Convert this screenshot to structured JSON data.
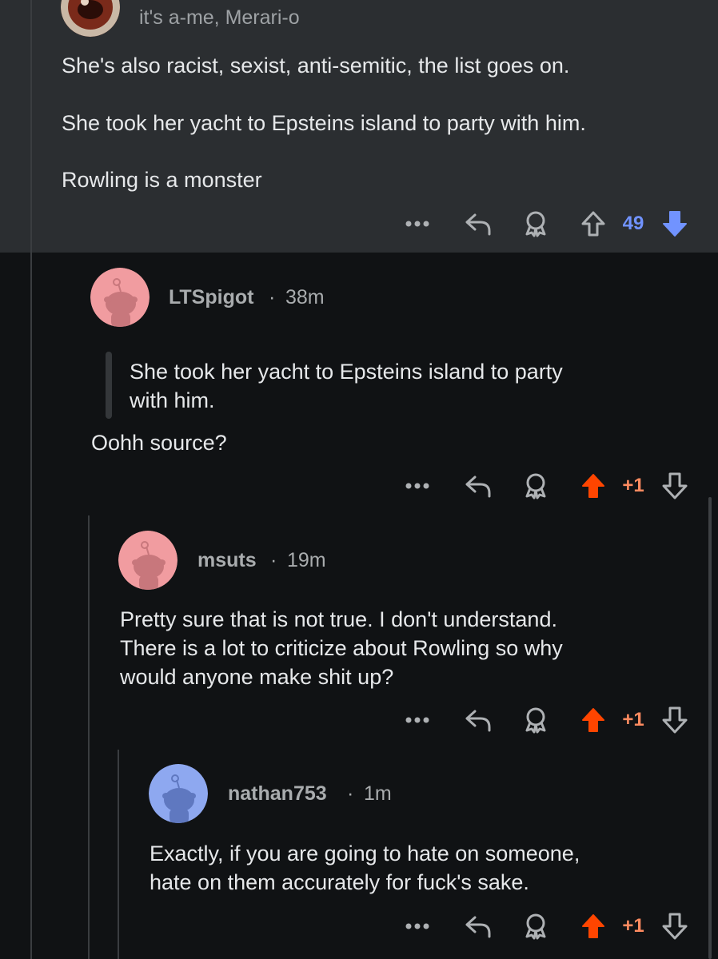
{
  "colors": {
    "background": "#101214",
    "top_comment_bg": "#2b2e31",
    "upvote": "#ff4500",
    "downvote": "#7193ff",
    "pink_avatar": "#f19ca0",
    "blue_avatar": "#8ea8f0"
  },
  "top_comment": {
    "flair": "it's a-me, Merari-o",
    "paragraphs": [
      "She's also racist, sexist, anti-semitic, the list goes on.",
      "She took her yacht to Epsteins island to party with him.",
      "Rowling is a monster"
    ],
    "score": "49",
    "vote_state": "downvoted",
    "icons": [
      "more-icon",
      "reply-icon",
      "award-icon",
      "upvote-icon",
      "downvote-icon"
    ]
  },
  "comments": [
    {
      "username": "LTSpigot",
      "separator": "·",
      "age": "38m",
      "quote": "She took her yacht to Epsteins island to party with him.",
      "quote_lines": [
        "She took her yacht to Epsteins island to party",
        "with him."
      ],
      "body_lines": [
        "Oohh source?"
      ],
      "score": "+1",
      "vote_state": "upvoted",
      "avatar_color": "pink"
    },
    {
      "username": "msuts",
      "separator": "·",
      "age": "19m",
      "body_lines": [
        "Pretty sure that is not true. I don't understand.",
        "There is a lot to criticize about Rowling so why",
        "would anyone make shit up?"
      ],
      "score": "+1",
      "vote_state": "upvoted",
      "avatar_color": "pink"
    },
    {
      "username": "nathan753",
      "separator": "·",
      "age": "1m",
      "body_lines": [
        "Exactly, if you are going to hate on someone,",
        "hate on them accurately for fuck's sake."
      ],
      "score": "+1",
      "vote_state": "upvoted",
      "avatar_color": "blue"
    }
  ]
}
